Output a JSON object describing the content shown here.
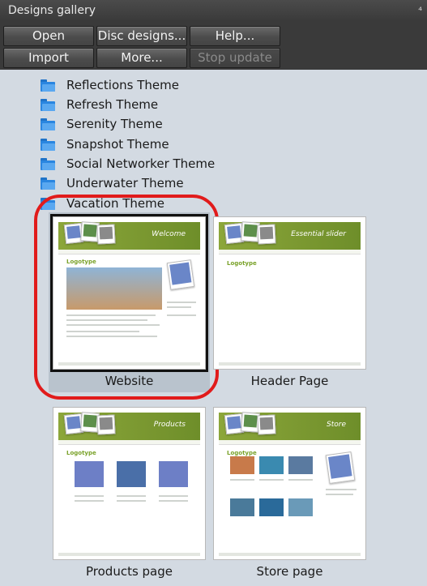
{
  "window": {
    "title": "Designs gallery",
    "grip": "⁴"
  },
  "toolbar": {
    "open": "Open",
    "disc_designs": "Disc designs...",
    "help": "Help...",
    "import": "Import",
    "more": "More...",
    "stop_update": "Stop update"
  },
  "themes": [
    "Reflections Theme",
    "Refresh Theme",
    "Serenity Theme",
    "Snapshot Theme",
    "Social Networker Theme",
    "Underwater Theme",
    "Vacation Theme"
  ],
  "thumbnails": {
    "website": {
      "label": "Website",
      "header": "Welcome",
      "logo": "Logotype",
      "selected": true
    },
    "header_page": {
      "label": "Header Page",
      "header": "Essential slider",
      "logo": "Logotype"
    },
    "products_page": {
      "label": "Products page",
      "header": "Products",
      "logo": "Logotype"
    },
    "store_page": {
      "label": "Store page",
      "header": "Store",
      "logo": "Logotype"
    }
  },
  "colors": {
    "accent_green": "#7a9a2e",
    "highlight_red": "#e11b1b",
    "folder_blue": "#2a86e0"
  }
}
